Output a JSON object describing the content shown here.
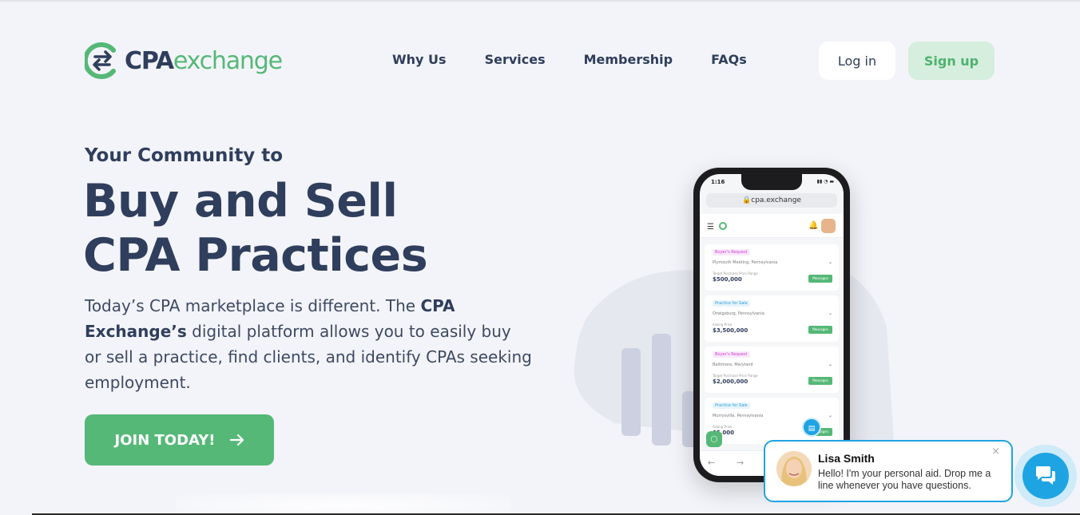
{
  "header": {
    "logo_cpa": "CPA",
    "logo_exchange": "exchange",
    "nav": [
      "Why Us",
      "Services",
      "Membership",
      "FAQs"
    ],
    "login_label": "Log in",
    "signup_label": "Sign up"
  },
  "hero": {
    "eyebrow": "Your Community to",
    "headline_line1": "Buy and Sell",
    "headline_line2": "CPA Practices",
    "desc_before": "Today’s CPA marketplace is different. The ",
    "desc_bold": "CPA Exchange’s",
    "desc_after": " digital platform allows you to easily buy or sell a practice, find clients, and identify CPAs seeking employment.",
    "cta_label": "JOIN TODAY!"
  },
  "phone": {
    "time": "1:16",
    "url": "cpa.exchange",
    "cards": [
      {
        "tag": "Buyer's Request",
        "tag_type": "buy",
        "location": "Plymouth Meeting, Pennsylvania",
        "label": "Target Purchase Price Range",
        "amount": "$500,000",
        "button": "Messages"
      },
      {
        "tag": "Practice for Sale",
        "tag_type": "sale",
        "location": "Orwigsburg, Pennsylvania",
        "label": "Asking Price",
        "amount": "$3,500,000",
        "button": "Messages"
      },
      {
        "tag": "Buyer's Request",
        "tag_type": "buy",
        "location": "Baltimore, Maryland",
        "label": "Target Purchase Price Range",
        "amount": "$2,000,000",
        "button": "Messages"
      },
      {
        "tag": "Practice for Sale",
        "tag_type": "sale",
        "location": "Murrysville, Pennsylvania",
        "label": "Asking Price",
        "amount": "$5,000",
        "button": "Messages"
      }
    ]
  },
  "chat": {
    "name": "Lisa Smith",
    "message": "Hello! I'm your personal aid. Drop me a line whenever you have questions.",
    "close": "×"
  },
  "colors": {
    "brand_green": "#55b877",
    "navy": "#2f3e5c",
    "chat_blue": "#1fa4e3",
    "background": "#f3f4f9"
  }
}
